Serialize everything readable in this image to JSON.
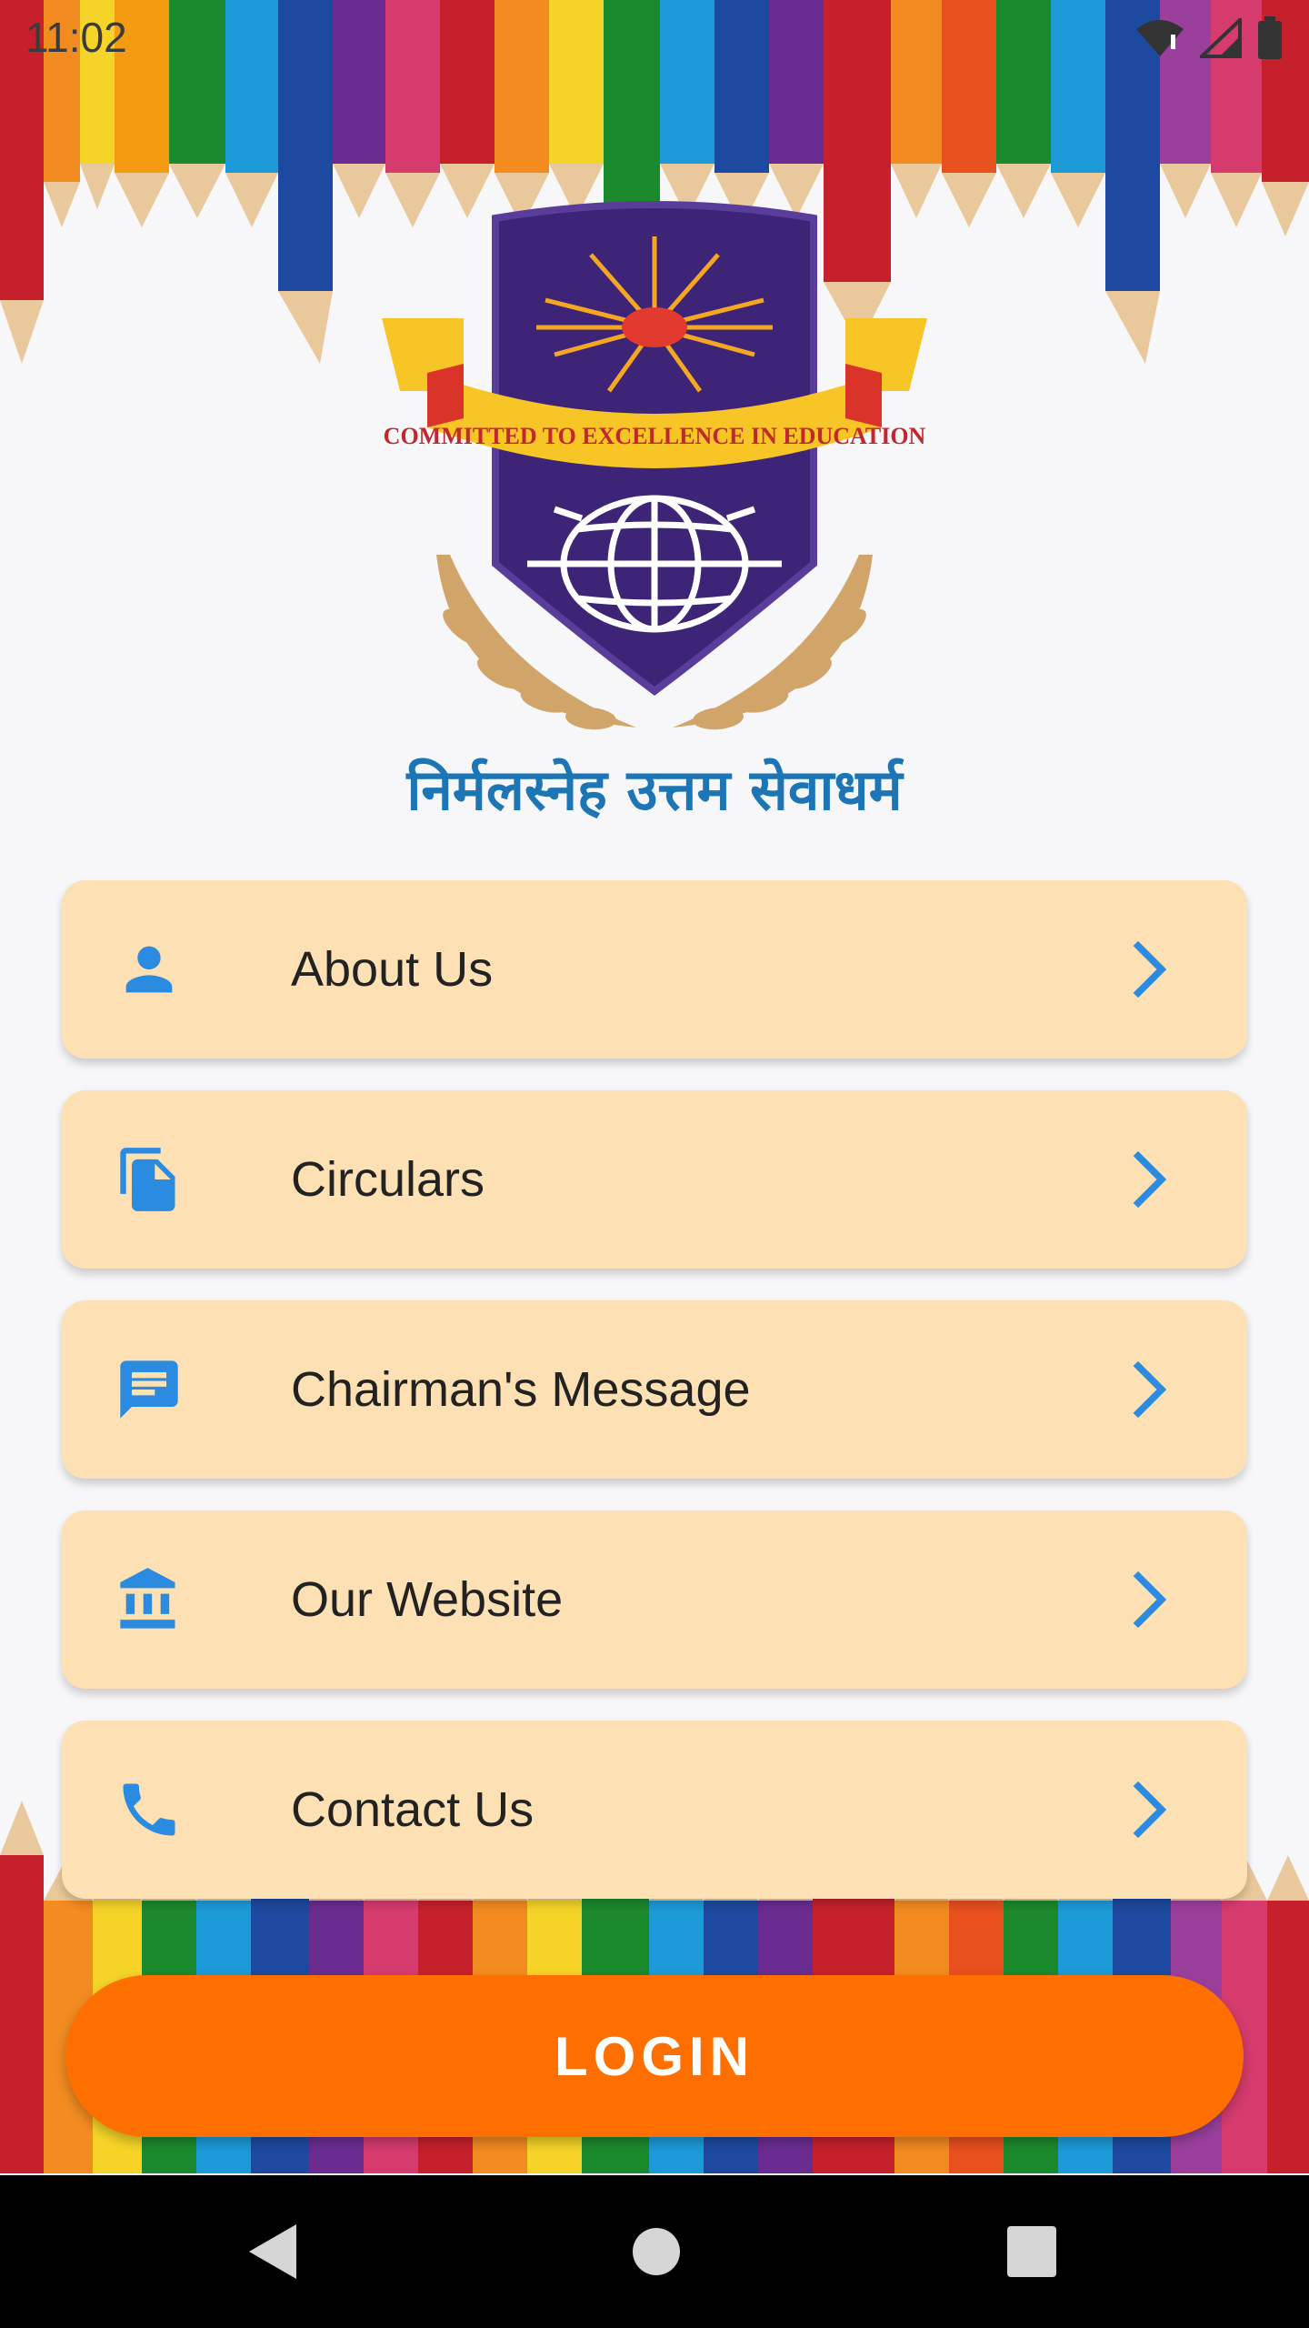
{
  "status_bar": {
    "time": "11:02",
    "icons": [
      "wifi-icon",
      "signal-icon",
      "battery-icon"
    ]
  },
  "logo": {
    "motto_ribbon": "COMMITTED TO EXCELLENCE IN EDUCATION",
    "hindi_text": "निर्मलस्नेह उत्तम सेवाधर्म",
    "colors": {
      "shield": "#3d2477",
      "ribbon": "#f7c626",
      "text": "#1c75b5",
      "laurel": "#d1a569"
    }
  },
  "menu": {
    "items": [
      {
        "label": "About Us",
        "icon": "person-icon"
      },
      {
        "label": "Circulars",
        "icon": "documents-icon"
      },
      {
        "label": "Chairman's Message",
        "icon": "message-icon"
      },
      {
        "label": "Our Website",
        "icon": "institution-icon"
      },
      {
        "label": "Contact Us",
        "icon": "phone-icon"
      }
    ],
    "card_color": "#fde1b4",
    "icon_color": "#2a8be0"
  },
  "login": {
    "label": "LOGIN",
    "color": "#ff6f00"
  },
  "nav": {
    "buttons": [
      "back-icon",
      "home-icon",
      "recents-icon"
    ]
  }
}
